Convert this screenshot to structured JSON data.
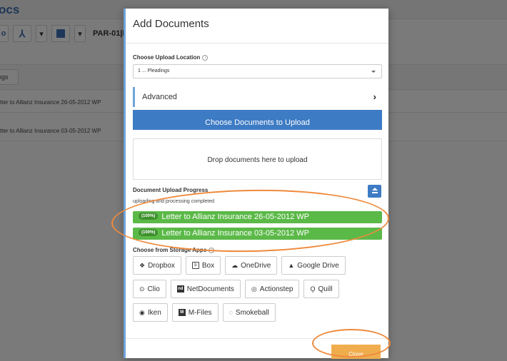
{
  "background": {
    "logo": "ocs",
    "code": "PAR-01|F",
    "pill": "ngs",
    "rows": [
      "tter to Allianz Insurance 26-05-2012 WP",
      "tter to Allianz Insurance 03-05-2012 WP"
    ]
  },
  "modal": {
    "title": "Add Documents",
    "upload_location_label": "Choose Upload Location",
    "upload_location_value": "1 ... Pleadings",
    "advanced_label": "Advanced",
    "choose_button": "Choose Documents to Upload",
    "dropzone": "Drop documents here to upload",
    "progress_label": "Document Upload Progress",
    "progress_status": "uploading and processing completed",
    "uploads": [
      {
        "percent": "(100%)",
        "name": "Letter to Allianz Insurance 26-05-2012 WP",
        "progress": 1.0
      },
      {
        "percent": "(100%)",
        "name": "Letter to Allianz Insurance 03-05-2012 WP",
        "progress": 1.0
      }
    ],
    "storage_label": "Choose from Storage Apps",
    "storage_apps": {
      "row1": [
        "Dropbox",
        "Box",
        "OneDrive",
        "Google Drive"
      ],
      "row2": [
        "Clio",
        "NetDocuments",
        "Actionstep",
        "Quill"
      ],
      "row3": [
        "Iken",
        "M-Files",
        "Smokeball"
      ]
    },
    "close_button": "Close"
  },
  "colors": {
    "primary": "#3d7bc4",
    "success": "#5bb948",
    "warning": "#f0ad4e",
    "annotation": "#ef8a3c"
  }
}
